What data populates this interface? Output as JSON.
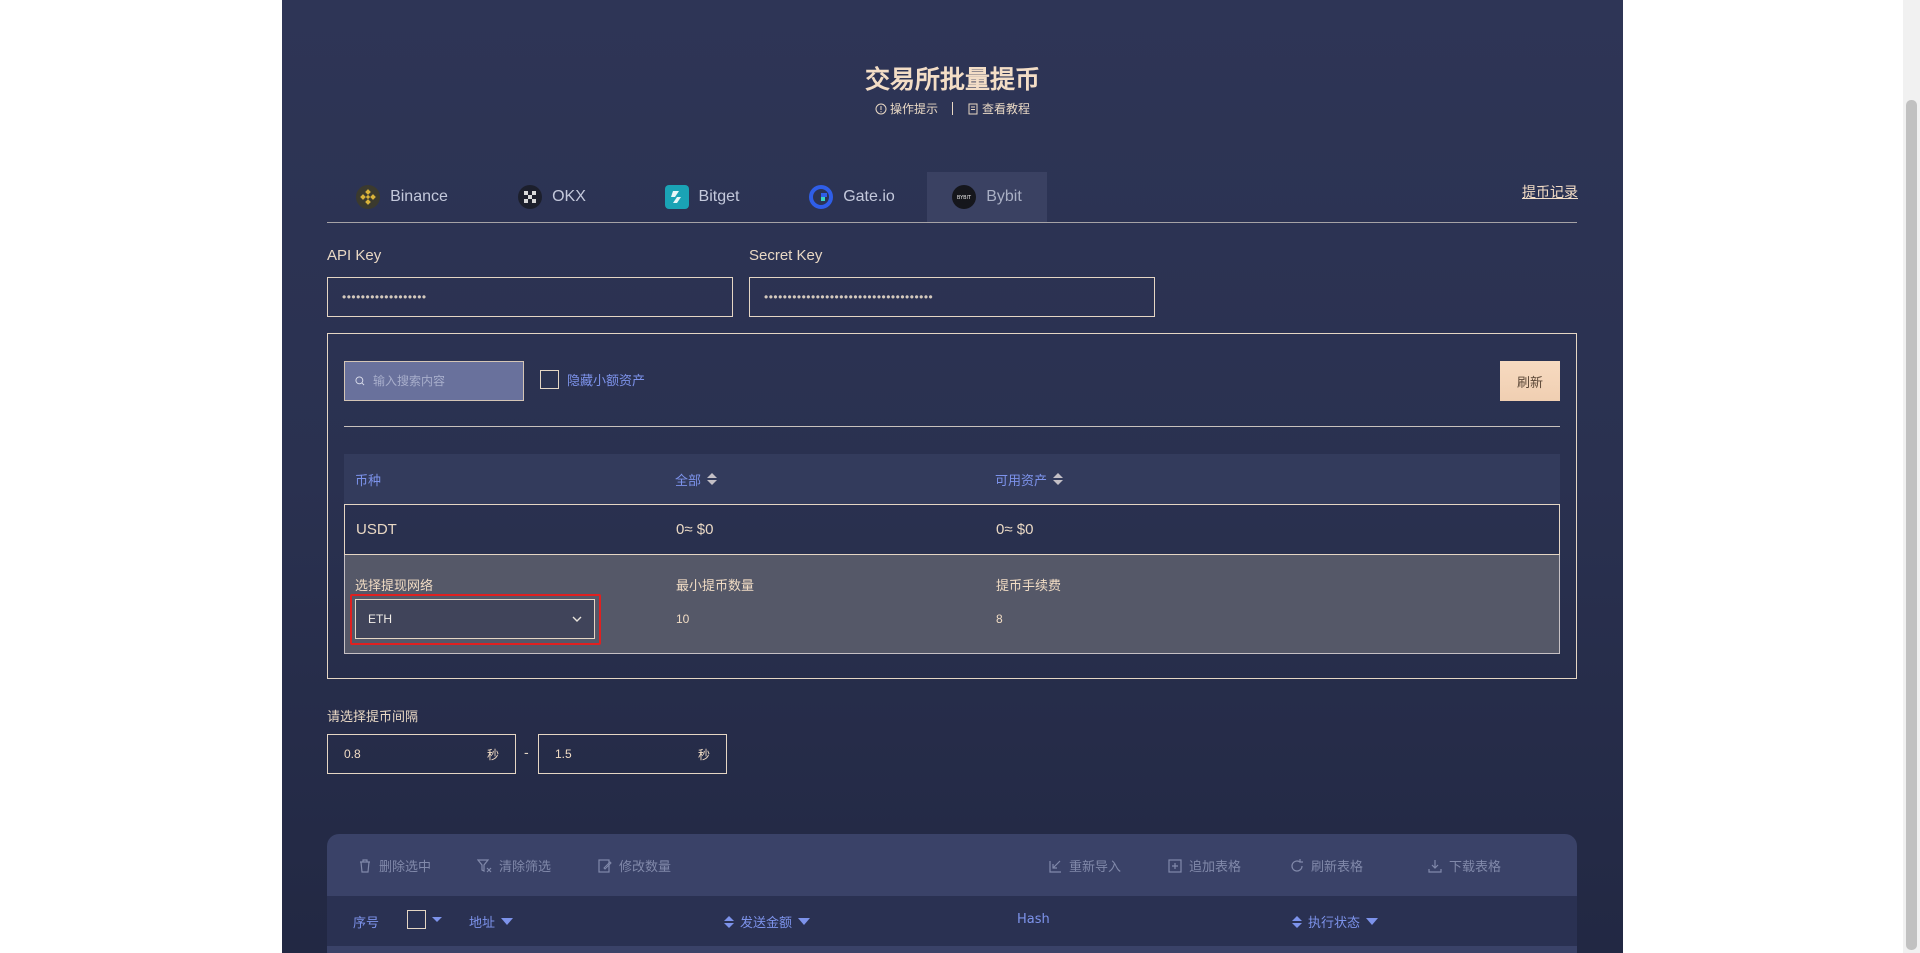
{
  "header": {
    "title": "交易所批量提币",
    "tips_label": "操作提示",
    "tutorial_label": "查看教程"
  },
  "tabs": [
    {
      "label": "Binance",
      "icon": "binance-logo"
    },
    {
      "label": "OKX",
      "icon": "okx-logo"
    },
    {
      "label": "Bitget",
      "icon": "bitget-logo"
    },
    {
      "label": "Gate.io",
      "icon": "gateio-logo"
    },
    {
      "label": "Bybit",
      "icon": "bybit-logo",
      "active": true
    }
  ],
  "record_link": "提币记录",
  "api_key": {
    "label": "API Key",
    "value": "••••••••••••••••••"
  },
  "secret_key": {
    "label": "Secret Key",
    "value": "••••••••••••••••••••••••••••••••••••"
  },
  "asset_panel": {
    "search_placeholder": "输入搜索内容",
    "hide_small_label": "隐藏小额资产",
    "refresh_label": "刷新",
    "columns": [
      "币种",
      "全部",
      "可用资产"
    ],
    "rows": [
      {
        "coin": "USDT",
        "total": "0≈ $0",
        "available": "0≈ $0"
      }
    ],
    "detail": {
      "network_label": "选择提现网络",
      "network_value": "ETH",
      "min_label": "最小提币数量",
      "min_value": "10",
      "fee_label": "提币手续费",
      "fee_value": "8"
    }
  },
  "interval": {
    "label": "请选择提币间隔",
    "min": "0.8",
    "max": "1.5",
    "unit": "秒",
    "separator": "-"
  },
  "table_toolbar": {
    "delete_selected": "删除选中",
    "clear_filter": "清除筛选",
    "modify_amount": "修改数量",
    "reimport": "重新导入",
    "append_table": "追加表格",
    "refresh_table": "刷新表格",
    "download_table": "下载表格"
  },
  "table_columns": {
    "index": "序号",
    "address": "地址",
    "amount": "发送金额",
    "hash": "Hash",
    "status": "执行状态"
  },
  "colors": {
    "panel_bg": "#2a3150",
    "accent_text": "#f3ddc6",
    "blue_text": "#7d93eb",
    "highlight": "#e02020"
  }
}
